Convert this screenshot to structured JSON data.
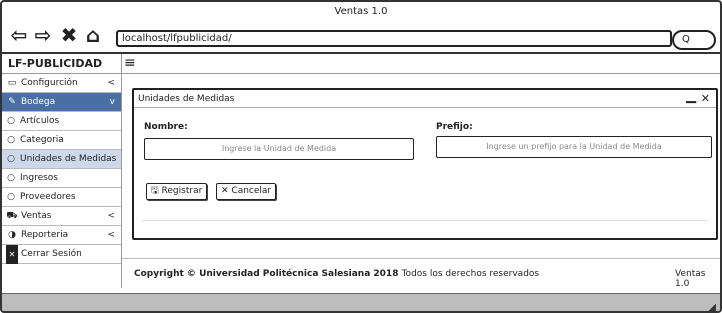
{
  "window": {
    "title": "Ventas 1.0"
  },
  "browser": {
    "url": "localhost/lfpublicidad/",
    "search_placeholder": "Q"
  },
  "app": {
    "brand": "LF-PUBLICIDAD"
  },
  "sidebar": {
    "items": [
      {
        "label": "Configurción",
        "icon": "monitor-icon",
        "chevron": "<"
      },
      {
        "label": "Bodega",
        "icon": "edit-icon",
        "chevron": "v"
      },
      {
        "label": "Artículos",
        "icon": "circle-icon"
      },
      {
        "label": "Categoria",
        "icon": "circle-icon"
      },
      {
        "label": "Unidades de Medidas",
        "icon": "circle-icon"
      },
      {
        "label": "Ingresos",
        "icon": "circle-icon"
      },
      {
        "label": "Proveedores",
        "icon": "circle-icon"
      },
      {
        "label": "Ventas",
        "icon": "cart-icon",
        "chevron": "<"
      },
      {
        "label": "Reporteria",
        "icon": "pie-icon",
        "chevron": "<"
      },
      {
        "label": "Cerrar Sesión",
        "icon": "logout-icon"
      }
    ]
  },
  "card": {
    "title": "Unidades de Medidas",
    "nombre_label": "Nombre:",
    "nombre_placeholder": "Ingrese la Unidad de Medida",
    "prefijo_label": "Prefijo:",
    "prefijo_placeholder": "Ingrese un prefijo para la Unidad de Medida",
    "register_label": "Registrar",
    "cancel_label": "Cancelar"
  },
  "footer": {
    "copyright": "Copyright",
    "org": "Universidad Politécnica Salesiana 2018",
    "rights": "Todos los derechos reservados",
    "version": "Ventas 1.0"
  }
}
